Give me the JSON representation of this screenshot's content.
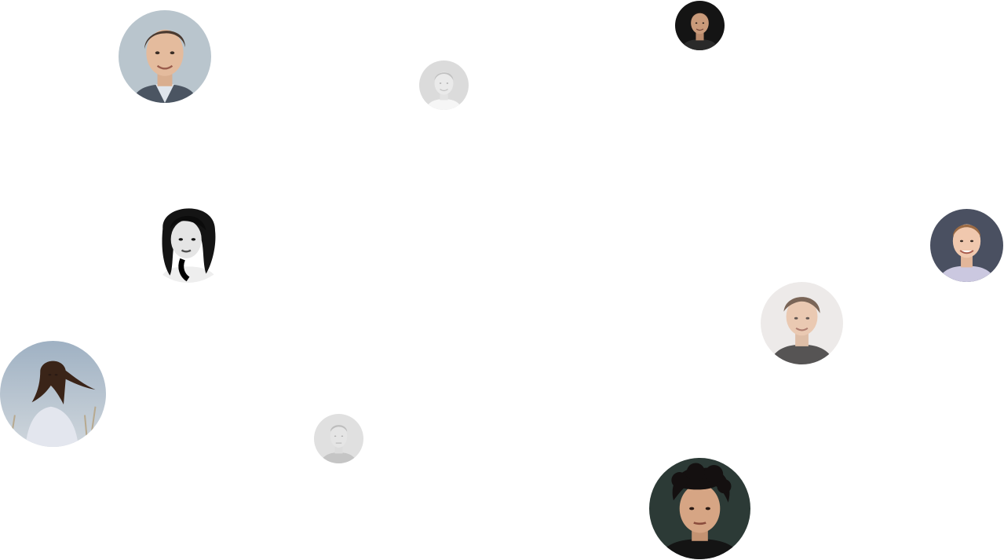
{
  "avatars": [
    {
      "id": "avatar-1",
      "description_icon": "man-portrait-light-bg",
      "style": "normal"
    },
    {
      "id": "avatar-2",
      "description_icon": "man-portrait-faded",
      "style": "faded"
    },
    {
      "id": "avatar-3",
      "description_icon": "man-portrait-dark-bg",
      "style": "normal"
    },
    {
      "id": "avatar-4",
      "description_icon": "girl-portrait-bw",
      "style": "grayscale"
    },
    {
      "id": "avatar-5",
      "description_icon": "man-portrait-dark-bg",
      "style": "normal"
    },
    {
      "id": "avatar-6",
      "description_icon": "man-portrait-light-bg",
      "style": "soft"
    },
    {
      "id": "avatar-7",
      "description_icon": "woman-portrait-sky-bg",
      "style": "normal"
    },
    {
      "id": "avatar-8",
      "description_icon": "man-portrait-faded",
      "style": "faded"
    },
    {
      "id": "avatar-9",
      "description_icon": "man-portrait-curly-hair",
      "style": "normal"
    }
  ],
  "colors": {
    "background": "#ffffff",
    "skin_light": "#e8c4a8",
    "skin_mid": "#d4a07e",
    "hair_dark": "#2a211c",
    "bg_grey_blue": "#b8c4cc",
    "bg_dark": "#1a1a1a",
    "bg_slate": "#4a5060",
    "bg_sky": "#aebccb"
  }
}
